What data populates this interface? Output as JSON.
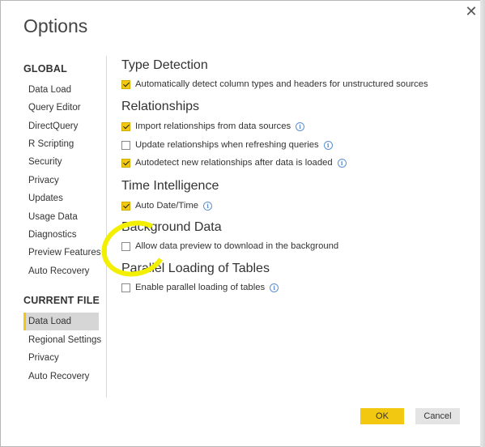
{
  "dialog": {
    "title": "Options",
    "close_glyph": "✕"
  },
  "sidebar": {
    "global_header": "GLOBAL",
    "global_items": [
      "Data Load",
      "Query Editor",
      "DirectQuery",
      "R Scripting",
      "Security",
      "Privacy",
      "Updates",
      "Usage Data",
      "Diagnostics",
      "Preview Features",
      "Auto Recovery"
    ],
    "current_header": "CURRENT FILE",
    "current_items": [
      "Data Load",
      "Regional Settings",
      "Privacy",
      "Auto Recovery"
    ],
    "selected": "Data Load"
  },
  "main": {
    "type_detection": {
      "heading": "Type Detection",
      "opt1": "Automatically detect column types and headers for unstructured sources"
    },
    "relationships": {
      "heading": "Relationships",
      "opt1": "Import relationships from data sources",
      "opt2": "Update relationships when refreshing queries",
      "opt3": "Autodetect new relationships after data is loaded"
    },
    "time_intelligence": {
      "heading": "Time Intelligence",
      "opt1": "Auto Date/Time"
    },
    "background_data": {
      "heading": "Background Data",
      "opt1": "Allow data preview to download in the background"
    },
    "parallel_loading": {
      "heading": "Parallel Loading of Tables",
      "opt1": "Enable parallel loading of tables"
    },
    "checked": {
      "td1": true,
      "rel1": true,
      "rel2": false,
      "rel3": true,
      "ti1": true,
      "bg1": false,
      "pl1": false
    },
    "info_glyph": "i"
  },
  "footer": {
    "ok_label": "OK",
    "cancel_label": "Cancel"
  },
  "colors": {
    "accent": "#f2c811",
    "info": "#5b8fd6",
    "highlight": "#f2ef00"
  }
}
